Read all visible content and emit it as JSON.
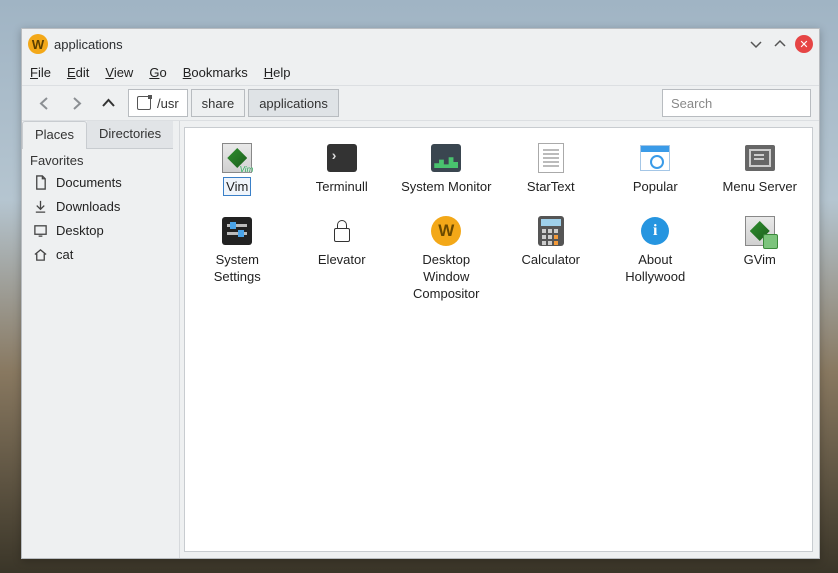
{
  "window": {
    "title": "applications"
  },
  "menubar": [
    "File",
    "Edit",
    "View",
    "Go",
    "Bookmarks",
    "Help"
  ],
  "toolbar": {
    "back_enabled": false,
    "forward_enabled": false,
    "up_enabled": true,
    "breadcrumbs": {
      "root": "/usr",
      "segments": [
        "share",
        "applications"
      ],
      "active_index": 1
    },
    "search_placeholder": "Search",
    "search_value": ""
  },
  "sidebar": {
    "tabs": [
      {
        "label": "Places",
        "active": true
      },
      {
        "label": "Directories",
        "active": false
      }
    ],
    "favorites_header": "Favorites",
    "favorites": [
      {
        "icon": "document-icon",
        "label": "Documents"
      },
      {
        "icon": "download-icon",
        "label": "Downloads"
      },
      {
        "icon": "desktop-icon",
        "label": "Desktop"
      },
      {
        "icon": "home-icon",
        "label": "cat"
      }
    ]
  },
  "files": [
    {
      "icon": "vim",
      "label": "Vim",
      "selected": true
    },
    {
      "icon": "term",
      "label": "Terminull",
      "selected": false
    },
    {
      "icon": "sysmon",
      "label": "System Monitor",
      "selected": false
    },
    {
      "icon": "text",
      "label": "StarText",
      "selected": false
    },
    {
      "icon": "pop",
      "label": "Popular",
      "selected": false
    },
    {
      "icon": "menu",
      "label": "Menu Server",
      "selected": false
    },
    {
      "icon": "settings",
      "label": "System Settings",
      "selected": false
    },
    {
      "icon": "lock",
      "label": "Elevator",
      "selected": false
    },
    {
      "icon": "w",
      "label": "Desktop Window Compositor",
      "selected": false
    },
    {
      "icon": "calc",
      "label": "Calculator",
      "selected": false
    },
    {
      "icon": "info",
      "label": "About Hollywood",
      "selected": false
    },
    {
      "icon": "gvim",
      "label": "GVim",
      "selected": false
    }
  ]
}
